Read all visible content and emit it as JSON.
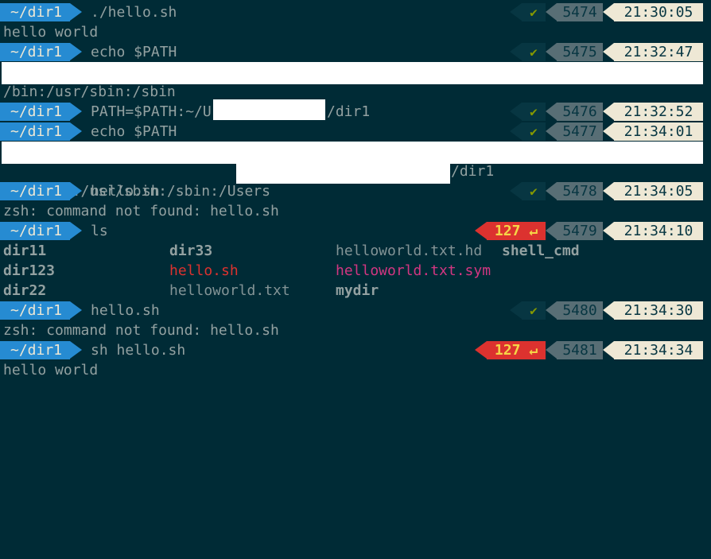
{
  "colors": {
    "background": "#002b36",
    "cwd_segment": "#268bd2",
    "ok_check": "#859900",
    "error_segment": "#dc322f",
    "history_segment": "#586e75",
    "time_segment": "#eee8d5"
  },
  "prompts": [
    {
      "cwd": "~/dir1",
      "command": "./hello.sh",
      "status": "✔",
      "history": "5474",
      "time": "21:30:05"
    },
    {
      "cwd": "~/dir1",
      "command": "echo $PATH",
      "status": "✔",
      "history": "5475",
      "time": "21:32:47"
    },
    {
      "cwd": "~/dir1",
      "command": "PATH=$PATH:~/U",
      "command_tail": "/dir1",
      "status": "✔",
      "history": "5476",
      "time": "21:32:52"
    },
    {
      "cwd": "~/dir1",
      "command": "echo $PATH",
      "status": "✔",
      "history": "5477",
      "time": "21:34:01"
    },
    {
      "cwd": "~/dir1",
      "command": "hello.sh",
      "status": "✔",
      "history": "5478",
      "time": "21:34:05"
    },
    {
      "cwd": "~/dir1",
      "command": "ls",
      "status": "127 ↵",
      "history": "5479",
      "time": "21:34:10"
    },
    {
      "cwd": "~/dir1",
      "command": "hello.sh",
      "status": "✔",
      "history": "5480",
      "time": "21:34:30"
    },
    {
      "cwd": "~/dir1",
      "command": "sh hello.sh",
      "status": "127 ↵",
      "history": "5481",
      "time": "21:34:34"
    }
  ],
  "outputs": {
    "hello1": "hello world",
    "path1": "/bin:/usr/sbin:/sbin",
    "path2_head": "/bin:/usr/sbin:/sbin:/Users",
    "path2_tail": "/dir1",
    "notfound1": "zsh: command not found: hello.sh",
    "notfound2": "zsh: command not found: hello.sh",
    "hello2": "hello world"
  },
  "ls_listing": [
    [
      "dir11",
      "dir33",
      "helloworld.txt.hd",
      "shell_cmd"
    ],
    [
      "dir123",
      "hello.sh",
      "helloworld.txt.sym"
    ],
    [
      "dir22",
      "helloworld.txt",
      "mydir"
    ]
  ]
}
